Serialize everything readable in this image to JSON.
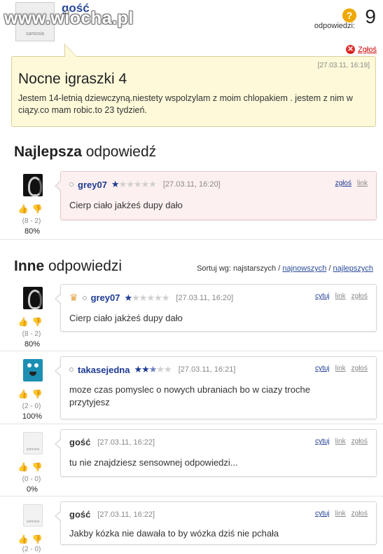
{
  "watermark": "www.wiocha.pl",
  "question": {
    "user": "gość",
    "avatar_text": "samosia",
    "answers_label": "odpowiedzi:",
    "answers_count": "9",
    "report_label": "Zgłoś",
    "date": "[27.03.11, 16:19]",
    "title": "Nocne igraszki 4",
    "body": "Jestem 14-letnią dziewczyną.niestety wspolzylam z moim chlopakiem . jestem z nim w ciązy.co mam robic.to 23 tydzień."
  },
  "best": {
    "title_bold": "Najlepsza",
    "title_rest": " odpowiedź",
    "answer": {
      "user": "grey07",
      "stars": "1 of 5",
      "date": "[27.03.11, 16:20]",
      "links": [
        "zgłoś",
        "link"
      ],
      "text": "Cierp ciało jakżeś dupy dało",
      "votes": "(8 - 2)",
      "percent": "80%"
    }
  },
  "others": {
    "title_bold": "Inne",
    "title_rest": " odpowiedzi",
    "sort_label": "Sortuj wg: najstarszych /",
    "sort_newest": "najnowszych",
    "sort_sep": "/",
    "sort_best": "najlepszych",
    "answers": [
      {
        "user": "grey07",
        "stars": "1 of 5",
        "date": "[27.03.11, 16:20]",
        "links": [
          "cytuj",
          "link",
          "zgłoś"
        ],
        "text": "Cierp ciało jakżeś dupy dało",
        "votes": "(8 - 2)",
        "percent": "80%"
      },
      {
        "user": "takasejedna",
        "stars": "2.5 of 5",
        "date": "[27.03.11, 16:21]",
        "links": [
          "cytuj",
          "link",
          "zgłoś"
        ],
        "text": "moze czas pomyslec o nowych ubraniach bo w ciazy troche przytyjesz",
        "votes": "(2 - 0)",
        "percent": "100%"
      },
      {
        "user": "gość",
        "date": "[27.03.11, 16:22]",
        "links": [
          "cytuj",
          "link",
          "zgłoś"
        ],
        "text": "tu nie znajdziesz sensownej odpowiedzi...",
        "votes": "(0 - 0)",
        "percent": "0%"
      },
      {
        "user": "gość",
        "date": "[27.03.11, 16:22]",
        "links": [
          "cytuj",
          "link",
          "zgłoś"
        ],
        "text": "Jakby kózka nie dawała to by wózka dziś nie pchała",
        "votes": "(2 - 0)",
        "percent": ""
      }
    ]
  },
  "colors": {
    "link": "#1d3a93",
    "question_bg": "#fdf9d9",
    "best_bg": "#fdf0f0"
  }
}
